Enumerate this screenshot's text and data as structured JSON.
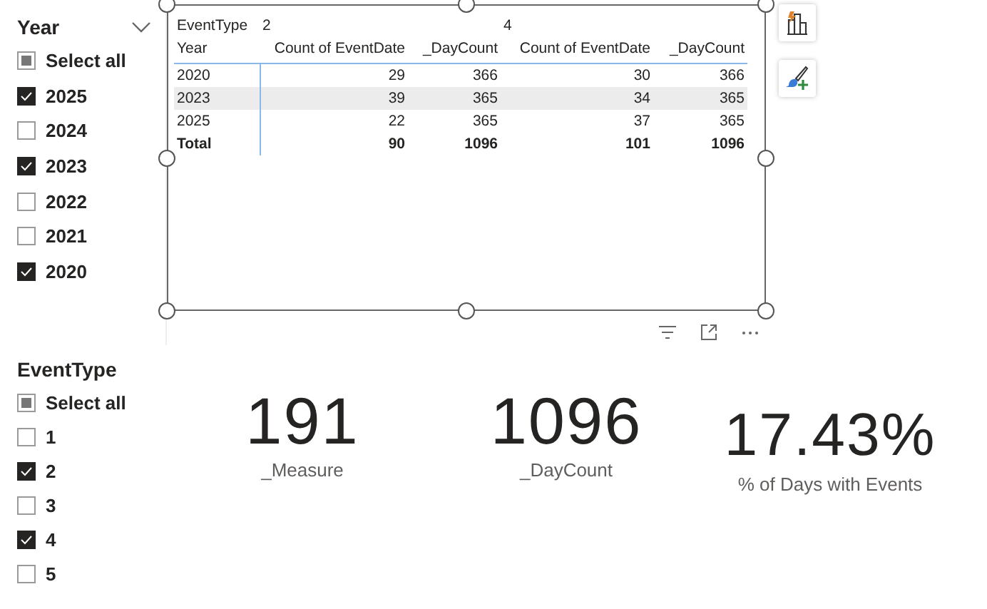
{
  "year_slicer": {
    "title": "Year",
    "select_all": {
      "label": "Select all",
      "partial": true
    },
    "items": [
      {
        "label": "2025",
        "checked": true
      },
      {
        "label": "2024",
        "checked": false
      },
      {
        "label": "2023",
        "checked": true
      },
      {
        "label": "2022",
        "checked": false
      },
      {
        "label": "2021",
        "checked": false
      },
      {
        "label": "2020",
        "checked": true
      }
    ]
  },
  "matrix": {
    "group_title": "EventType",
    "column_groups": [
      "2",
      "4"
    ],
    "columns": [
      "Year",
      "Count of EventDate",
      "_DayCount",
      "Count of EventDate",
      "_DayCount"
    ],
    "rows": [
      {
        "cells": [
          "2020",
          "29",
          "366",
          "30",
          "366"
        ],
        "highlighted": false,
        "kind": "data"
      },
      {
        "cells": [
          "2023",
          "39",
          "365",
          "34",
          "365"
        ],
        "highlighted": true,
        "kind": "data"
      },
      {
        "cells": [
          "2025",
          "22",
          "365",
          "37",
          "365"
        ],
        "highlighted": false,
        "kind": "data"
      },
      {
        "cells": [
          "Total",
          "90",
          "1096",
          "101",
          "1096"
        ],
        "highlighted": false,
        "kind": "total"
      }
    ]
  },
  "event_slicer": {
    "title": "EventType",
    "select_all": {
      "label": "Select all",
      "partial": true
    },
    "items": [
      {
        "label": "1",
        "checked": false
      },
      {
        "label": "2",
        "checked": true
      },
      {
        "label": "3",
        "checked": false
      },
      {
        "label": "4",
        "checked": true
      },
      {
        "label": "5",
        "checked": false
      }
    ]
  },
  "cards": [
    {
      "value": "191",
      "label": "_Measure"
    },
    {
      "value": "1096",
      "label": "_DayCount"
    },
    {
      "value": "17.43%",
      "label": "% of Days with Events"
    }
  ]
}
